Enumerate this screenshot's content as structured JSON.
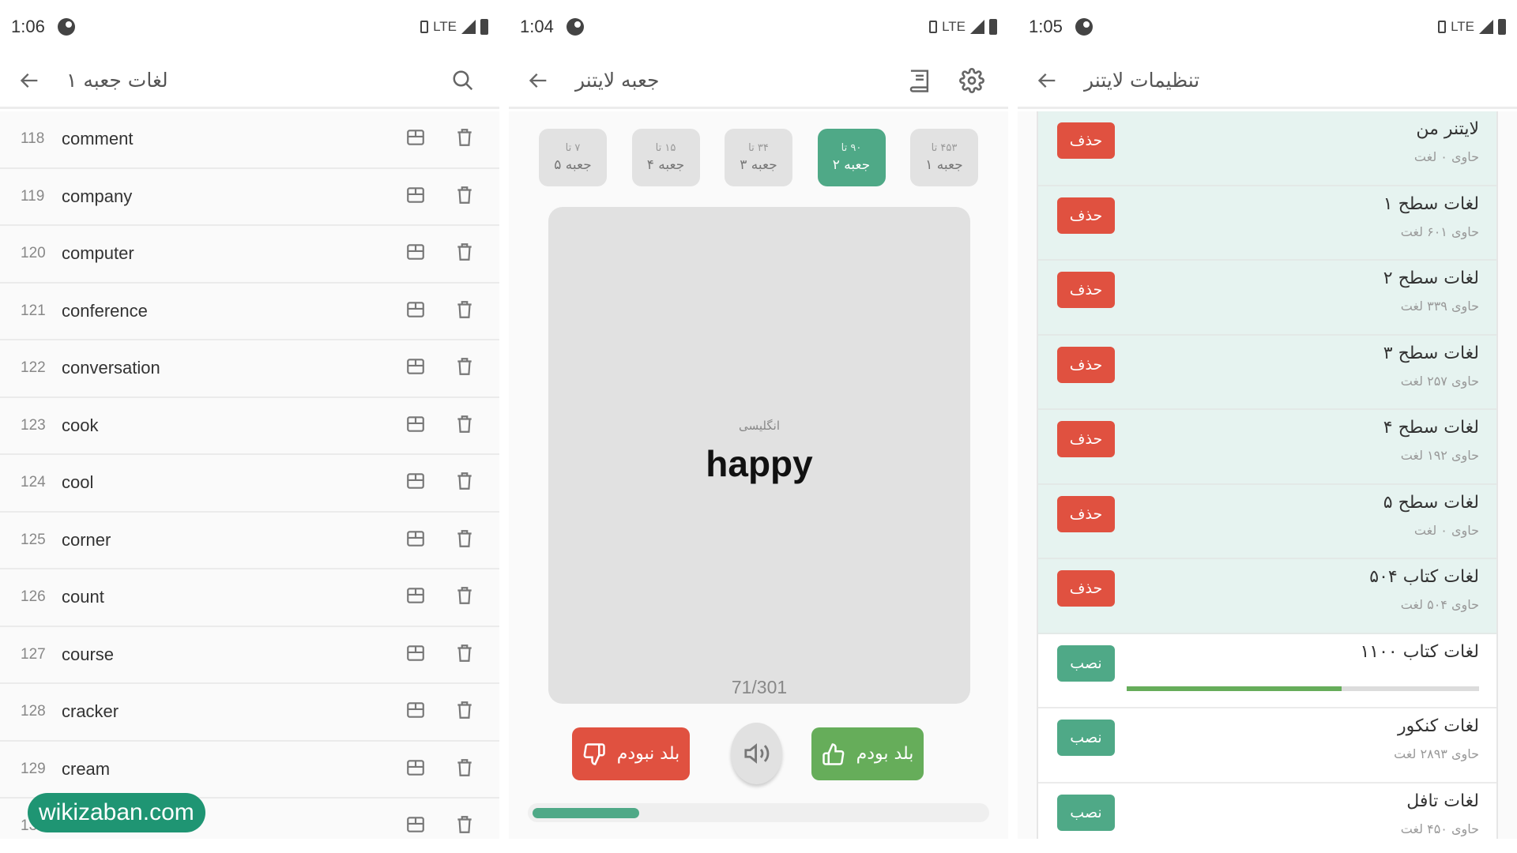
{
  "screens": [
    {
      "status": {
        "time": "1:06",
        "network": "LTE"
      },
      "header": {
        "title": "لغات جعبه ۱"
      },
      "words": [
        {
          "num": "118",
          "word": "comment"
        },
        {
          "num": "119",
          "word": "company"
        },
        {
          "num": "120",
          "word": "computer"
        },
        {
          "num": "121",
          "word": "conference"
        },
        {
          "num": "122",
          "word": "conversation"
        },
        {
          "num": "123",
          "word": "cook"
        },
        {
          "num": "124",
          "word": "cool"
        },
        {
          "num": "125",
          "word": "corner"
        },
        {
          "num": "126",
          "word": "count"
        },
        {
          "num": "127",
          "word": "course"
        },
        {
          "num": "128",
          "word": "cracker"
        },
        {
          "num": "129",
          "word": "cream"
        },
        {
          "num": "130",
          "word": ""
        }
      ],
      "watermark": "wikizaban.com"
    },
    {
      "status": {
        "time": "1:04",
        "network": "LTE"
      },
      "header": {
        "title": "جعبه لایتنر"
      },
      "boxes": [
        {
          "name": "جعبه ۱",
          "count": "۴۵۳ تا",
          "active": false
        },
        {
          "name": "جعبه ۲",
          "count": "۹۰ تا",
          "active": true
        },
        {
          "name": "جعبه ۳",
          "count": "۳۴ تا",
          "active": false
        },
        {
          "name": "جعبه ۴",
          "count": "۱۵ تا",
          "active": false
        },
        {
          "name": "جعبه ۵",
          "count": "۷ تا",
          "active": false
        }
      ],
      "card": {
        "language": "انگلیسی",
        "word": "happy",
        "counter": "71/301"
      },
      "buttons": {
        "knew": "بلد بودم",
        "didnt_know": "بلد نبودم"
      },
      "progress": {
        "current": 71,
        "total": 301
      }
    },
    {
      "status": {
        "time": "1:05",
        "network": "LTE"
      },
      "header": {
        "title": "تنظیمات لایتنر"
      },
      "packages": [
        {
          "title": "لایتنر من",
          "subtitle": "حاوی ۰ لغت",
          "action": "حذف",
          "installed": true
        },
        {
          "title": "لغات سطح ۱",
          "subtitle": "حاوی ۶۰۱ لغت",
          "action": "حذف",
          "installed": true
        },
        {
          "title": "لغات سطح ۲",
          "subtitle": "حاوی ۳۳۹ لغت",
          "action": "حذف",
          "installed": true
        },
        {
          "title": "لغات سطح ۳",
          "subtitle": "حاوی ۲۵۷ لغت",
          "action": "حذف",
          "installed": true
        },
        {
          "title": "لغات سطح ۴",
          "subtitle": "حاوی ۱۹۲ لغت",
          "action": "حذف",
          "installed": true
        },
        {
          "title": "لغات سطح ۵",
          "subtitle": "حاوی ۰ لغت",
          "action": "حذف",
          "installed": true
        },
        {
          "title": "لغات کتاب ۵۰۴",
          "subtitle": "حاوی ۵۰۴ لغت",
          "action": "حذف",
          "installed": true
        },
        {
          "title": "لغات کتاب ۱۱۰۰",
          "subtitle": "",
          "action": "نصب",
          "installed": false,
          "download_progress": 0.61
        },
        {
          "title": "لغات کنکور",
          "subtitle": "حاوی ۲۸۹۳ لغت",
          "action": "نصب",
          "installed": false
        },
        {
          "title": "لغات تافل",
          "subtitle": "حاوی ۴۵۰ لغت",
          "action": "نصب",
          "installed": false
        }
      ]
    }
  ],
  "colors": {
    "accent_green": "#4fa987",
    "success_green": "#66ad5a",
    "danger_red": "#e05140",
    "installed_row_bg": "#e6f3f0"
  }
}
